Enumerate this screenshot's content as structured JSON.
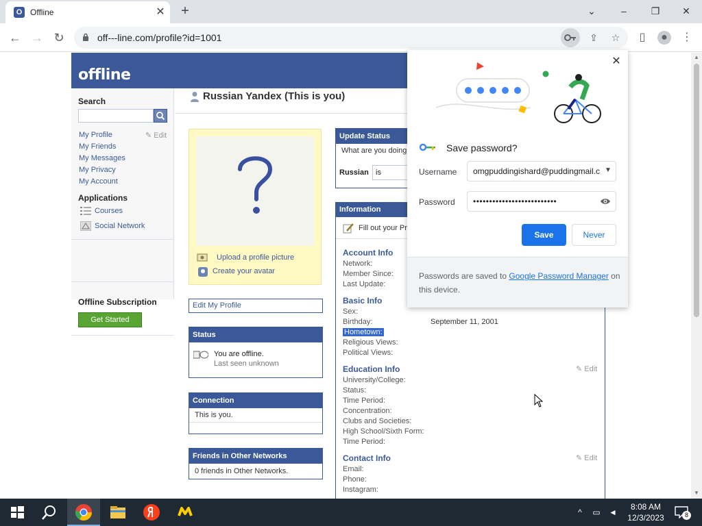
{
  "browser": {
    "tab_title": "Offline",
    "tab_favicon_letter": "O",
    "url": "off---line.com/profile?id=1001"
  },
  "site": {
    "logo": "offline",
    "sidebar": {
      "search_label": "Search",
      "links": [
        "My Profile",
        "My Friends",
        "My Messages",
        "My Privacy",
        "My Account"
      ],
      "edit_label": "Edit",
      "applications_label": "Applications",
      "apps": [
        "Courses",
        "Social Network"
      ],
      "subscription_title": "Offline Subscription",
      "get_started_label": "Get Started"
    },
    "profile": {
      "name": "Russian Yandex (This is you)",
      "upload_label": "Upload a profile picture",
      "avatar_label": "Create your avatar",
      "edit_profile_label": "Edit My Profile",
      "status_title": "Status",
      "status_text": "You are offline.",
      "status_seen": "Last seen unknown",
      "connection_title": "Connection",
      "connection_text": "This is you.",
      "friends_title": "Friends in Other Networks",
      "friends_text": "0 friends in Other Networks."
    },
    "update_status": {
      "title": "Update Status",
      "prompt": "What are you doing",
      "name": "Russian",
      "value": "is"
    },
    "information": {
      "title": "Information",
      "fill_out": "Fill out your Pr",
      "account_title": "Account Info",
      "account_labels": [
        "Network:",
        "Member Since:",
        "Last Update:"
      ],
      "basic_title": "Basic Info",
      "basic_labels": [
        "Sex:",
        "Birthday:",
        "Hometown:",
        "Religious Views:",
        "Political Views:"
      ],
      "birthday_value": "September 11, 2001",
      "education_title": "Education Info",
      "education_labels": [
        "University/College:",
        "Status:",
        "Time Period:",
        "Concentration:",
        "Clubs and Societies:",
        "High School/Sixth Form:",
        "Time Period:"
      ],
      "contact_title": "Contact Info",
      "contact_labels": [
        "Email:",
        "Phone:",
        "Instagram:"
      ],
      "edit_label": "Edit"
    }
  },
  "password_popup": {
    "title": "Save password?",
    "username_label": "Username",
    "username_value": "omgpuddingishard@puddingmail.c",
    "password_label": "Password",
    "password_value": "••••••••••••••••••••••••••",
    "save_label": "Save",
    "never_label": "Never",
    "footer_text_before": "Passwords are saved to ",
    "footer_link": "Google Password Manager",
    "footer_text_after": " on this device."
  },
  "taskbar": {
    "time": "8:08 AM",
    "date": "12/3/2023",
    "notification_count": "8"
  },
  "colors": {
    "brand": "#3b5998",
    "save_button": "#1a73e8",
    "get_started": "#59a534"
  }
}
